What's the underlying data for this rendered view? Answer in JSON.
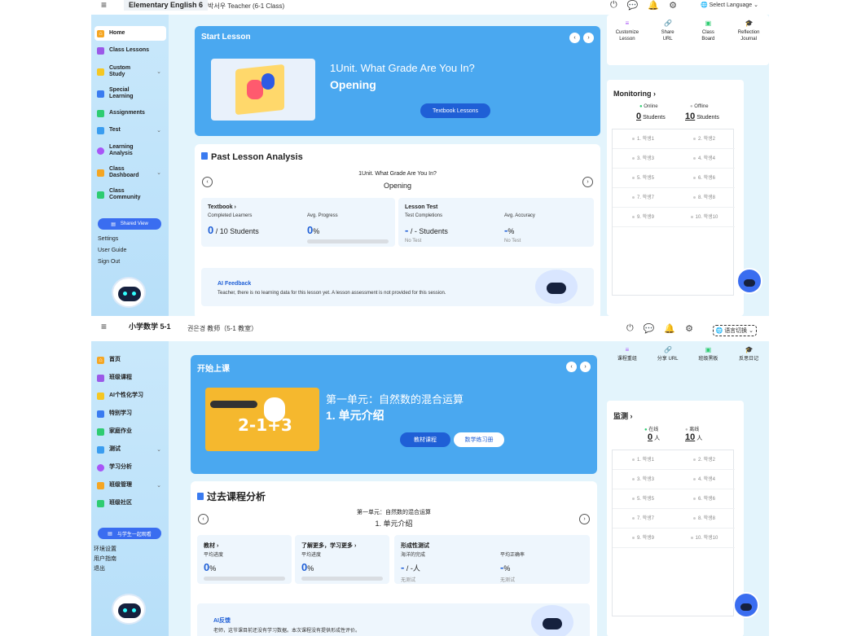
{
  "panel1": {
    "topbar": {
      "title": "Elementary English 6",
      "teacher": "박서우 Teacher (6-1 Class)",
      "language": "Select Language"
    },
    "sidebar": {
      "items": [
        {
          "label": "Home",
          "color": "#f5a623"
        },
        {
          "label": "Class Lessons",
          "color": "#9b59e8"
        },
        {
          "label": "Custom Study",
          "color": "#f5c723"
        },
        {
          "label": "Special Learning",
          "color": "#3a7bf0"
        },
        {
          "label": "Assignments",
          "color": "#2ecc71"
        },
        {
          "label": "Test",
          "color": "#3a9df0"
        },
        {
          "label": "Learning Analysis",
          "color": "#a855f7"
        },
        {
          "label": "Class Dashboard",
          "color": "#f5a623"
        },
        {
          "label": "Class Community",
          "color": "#2ecc71"
        }
      ],
      "shared_view": "Shared View",
      "settings": "Settings",
      "user_guide": "User Guide",
      "sign_out": "Sign Out"
    },
    "hero": {
      "heading": "Start Lesson",
      "unit": "1Unit. What Grade Are You In?",
      "subtitle": "Opening",
      "button": "Textbook Lessons"
    },
    "past": {
      "title": "Past Lesson Analysis",
      "unit": "1Unit. What Grade Are You In?",
      "subtitle": "Opening",
      "textbook": {
        "header": "Textbook",
        "l1": "Completed Learners",
        "v1": "0",
        "v1u": "/ 10 Students",
        "l2": "Avg. Progress",
        "v2": "0",
        "v2u": "%",
        "progress": 0
      },
      "test": {
        "header": "Lesson Test",
        "l1": "Test Completions",
        "v1": "-",
        "v1u": "/ - Students",
        "l2": "Avg. Accuracy",
        "v2": "-",
        "v2u": "%",
        "n1": "No Test",
        "n2": "No Test"
      },
      "ai": {
        "header": "AI Feedback",
        "text": "Teacher, there is no learning data for this lesson yet. A lesson assessment is not provided for this session."
      }
    },
    "tools": [
      {
        "label": "Customize Lesson",
        "icon": "≡"
      },
      {
        "label": "Share URL",
        "icon": "⛓"
      },
      {
        "label": "Class Board",
        "icon": "▣"
      },
      {
        "label": "Reflection Journal",
        "icon": "🎓"
      }
    ],
    "monitoring": {
      "title": "Monitoring",
      "online": "Online",
      "offline": "Offline",
      "online_count": "0",
      "offline_count": "10",
      "unit": "Students",
      "students": [
        "1. 학생1",
        "2. 학생2",
        "3. 학생3",
        "4. 학생4",
        "5. 학생5",
        "6. 학생6",
        "7. 학생7",
        "8. 학생8",
        "9. 학생9",
        "10. 학생10"
      ]
    },
    "fab": "AI Assistant Teacher"
  },
  "panel2": {
    "topbar": {
      "title": "小学数学 5-1",
      "teacher": "권은경 教师（5-1 教室）",
      "language": "语言切换"
    },
    "sidebar": {
      "items": [
        {
          "label": "首页",
          "color": "#f5a623"
        },
        {
          "label": "班级课程",
          "color": "#9b59e8"
        },
        {
          "label": "AI个性化学习",
          "color": "#f5c723"
        },
        {
          "label": "特别学习",
          "color": "#3a7bf0"
        },
        {
          "label": "家庭作业",
          "color": "#2ecc71"
        },
        {
          "label": "测试",
          "color": "#3a9df0"
        },
        {
          "label": "学习分析",
          "color": "#a855f7"
        },
        {
          "label": "班级管理",
          "color": "#f5a623"
        },
        {
          "label": "班级社区",
          "color": "#2ecc71"
        }
      ],
      "shared_view": "与学生一起观看",
      "settings": "环境设置",
      "user_guide": "用户指南",
      "sign_out": "退出"
    },
    "hero": {
      "heading": "开始上课",
      "unit": "第一单元：自然数的混合运算",
      "subtitle": "1. 单元介绍",
      "button": "教材课程",
      "button2": "数学练习册"
    },
    "past": {
      "title": "过去课程分析",
      "unit": "第一单元：自然数的混合运算",
      "subtitle": "1. 单元介绍",
      "textbook": {
        "header": "教材",
        "l1": "平均进度",
        "v1": "0",
        "v1u": "%"
      },
      "more": {
        "header": "了解更多，学习更多",
        "l1": "平均进度",
        "v1": "0",
        "v1u": "%"
      },
      "test": {
        "header": "形成性测试",
        "l1": "海洋的完成",
        "v1": "-",
        "v1u": "/ -人",
        "l2": "平均正确率",
        "v2": "-",
        "v2u": "%",
        "n1": "无测试",
        "n2": "无测试"
      },
      "ai": {
        "header": "AI反馈",
        "text": "老师，这节课目前还没有学习数据。本次课程没有提供形成性评价。"
      }
    },
    "tools": [
      {
        "label": "课程重组",
        "icon": "≡"
      },
      {
        "label": "分享 URL",
        "icon": "⛓"
      },
      {
        "label": "班级黑板",
        "icon": "▣"
      },
      {
        "label": "反思日记",
        "icon": "🎓"
      }
    ],
    "monitoring": {
      "title": "监测",
      "online": "在线",
      "offline": "离线",
      "online_count": "0",
      "offline_count": "10",
      "unit": "人",
      "students": [
        "1. 학생1",
        "2. 학생2",
        "3. 학생3",
        "4. 학생4",
        "5. 학생5",
        "6. 학생6",
        "7. 학생7",
        "8. 학생8",
        "9. 학생9",
        "10. 학생10"
      ]
    },
    "fab": "AI助教教师"
  }
}
